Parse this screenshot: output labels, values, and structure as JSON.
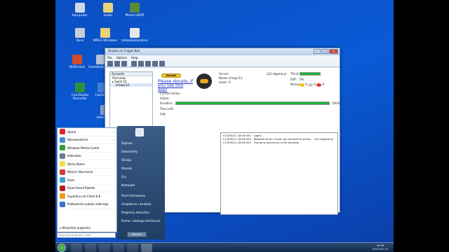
{
  "desktop": {
    "icons": [
      {
        "label": "Komputer",
        "color": "#cfd8e6"
      },
      {
        "label": "koder",
        "color": "#e8d27a"
      },
      {
        "label": "MinecraftSP",
        "color": "#5a8a3a"
      },
      {
        "label": "Kosz",
        "color": "#c6ced9"
      },
      {
        "label": "MPEG Windows",
        "color": "#e8d27a"
      },
      {
        "label": "tampdeklaration",
        "color": "#e8e8e8"
      },
      {
        "label": "BitTorrent",
        "color": "#d24a2a"
      },
      {
        "label": "CamStudio Pack",
        "color": "#b8c4d6"
      },
      {
        "label": "CamStudio Recorder",
        "color": "#2f8f3f"
      },
      {
        "label": "Camtasia",
        "color": "#3f7fd6"
      },
      {
        "label": "Ustawienia",
        "color": "#8aa2c8"
      }
    ]
  },
  "window": {
    "title": "Shakes & Fidget Bot",
    "menu": [
      "File",
      "Options",
      "Help"
    ],
    "close": "x",
    "accounts": {
      "header": "Accounts",
      "items": [
        "Overview",
        "Swiat 22",
        "chrapci11"
      ]
    },
    "donate_label": "Donate",
    "please_text": "Please donate, if you like this app!",
    "server_label": "Server:",
    "server_value": "s22.sfgame.pl",
    "name_label": "Name:",
    "name_value": "chrapci11",
    "level_label": "Level:",
    "level_value": "0",
    "thirst_label": "Thirst:",
    "exp_label": "EXP:",
    "exp_value": "0%",
    "money_label": "Money:",
    "money": [
      {
        "value": "0",
        "color": "#f0c419"
      },
      {
        "value": "0",
        "color": "#c9c9c9"
      },
      {
        "value": "0",
        "color": "#d9412e"
      }
    ],
    "current_action_label": "Current Action",
    "action_label": "Action:",
    "action_value": "",
    "duration_label": "Duration:",
    "duration_percent": "100%",
    "duration_fraction": 1.0,
    "thirst_fraction": 1.0,
    "time_left_label": "Time Left:",
    "log_label": "Log:",
    "log": [
      {
        "time": "<13/05/12 18:09:43>",
        "text": "Login...",
        "server": ""
      },
      {
        "time": "<13/05/12 18:09:43>",
        "text": "Network Error: Could not connect to server",
        "server": "s22.sfgame.pl"
      },
      {
        "time": "<13/05/12 18:09:43>",
        "text": "Trying to reconnect in 60 seconds.",
        "server": ""
      }
    ]
  },
  "start_menu": {
    "left_items": [
      {
        "label": "Opera",
        "color": "#d8262b",
        "arrow": "›"
      },
      {
        "label": "Wprowadzenie",
        "color": "#3f8fd8",
        "arrow": "›"
      },
      {
        "label": "Windows Media Center",
        "color": "#2e9e3e",
        "arrow": ""
      },
      {
        "label": "Kalkulator",
        "color": "#6c7c94",
        "arrow": ""
      },
      {
        "label": "Sticky Notes",
        "color": "#f1dd4b",
        "arrow": ""
      },
      {
        "label": "Nożyce Wycinanie",
        "color": "#d23a3a",
        "arrow": ""
      },
      {
        "label": "Paint",
        "color": "#3aa0d8",
        "arrow": ""
      },
      {
        "label": "Dead Island Riptide",
        "color": "#b41f1f",
        "arrow": ""
      },
      {
        "label": "SuperEco.net Client 8.8",
        "color": "#f09a1a",
        "arrow": ""
      },
      {
        "label": "Podłączanie pulpitu zdalnego",
        "color": "#3f6fd0",
        "arrow": ""
      }
    ],
    "all_programs": "Wszystkie programy",
    "search_placeholder": "Wyszukaj programy i pliki",
    "right_items": [
      "Szymon",
      "Dokumenty",
      "Obrazy",
      "Muzyka",
      "Gry",
      "Komputer",
      "Panel sterowania",
      "Urządzenia i drukarki",
      "Programy domyślne",
      "Pomoc i obsługa techniczna"
    ],
    "shutdown_label": "Zamknij"
  },
  "taskbar": {
    "time": "18:09",
    "date": "2013-05-12"
  }
}
